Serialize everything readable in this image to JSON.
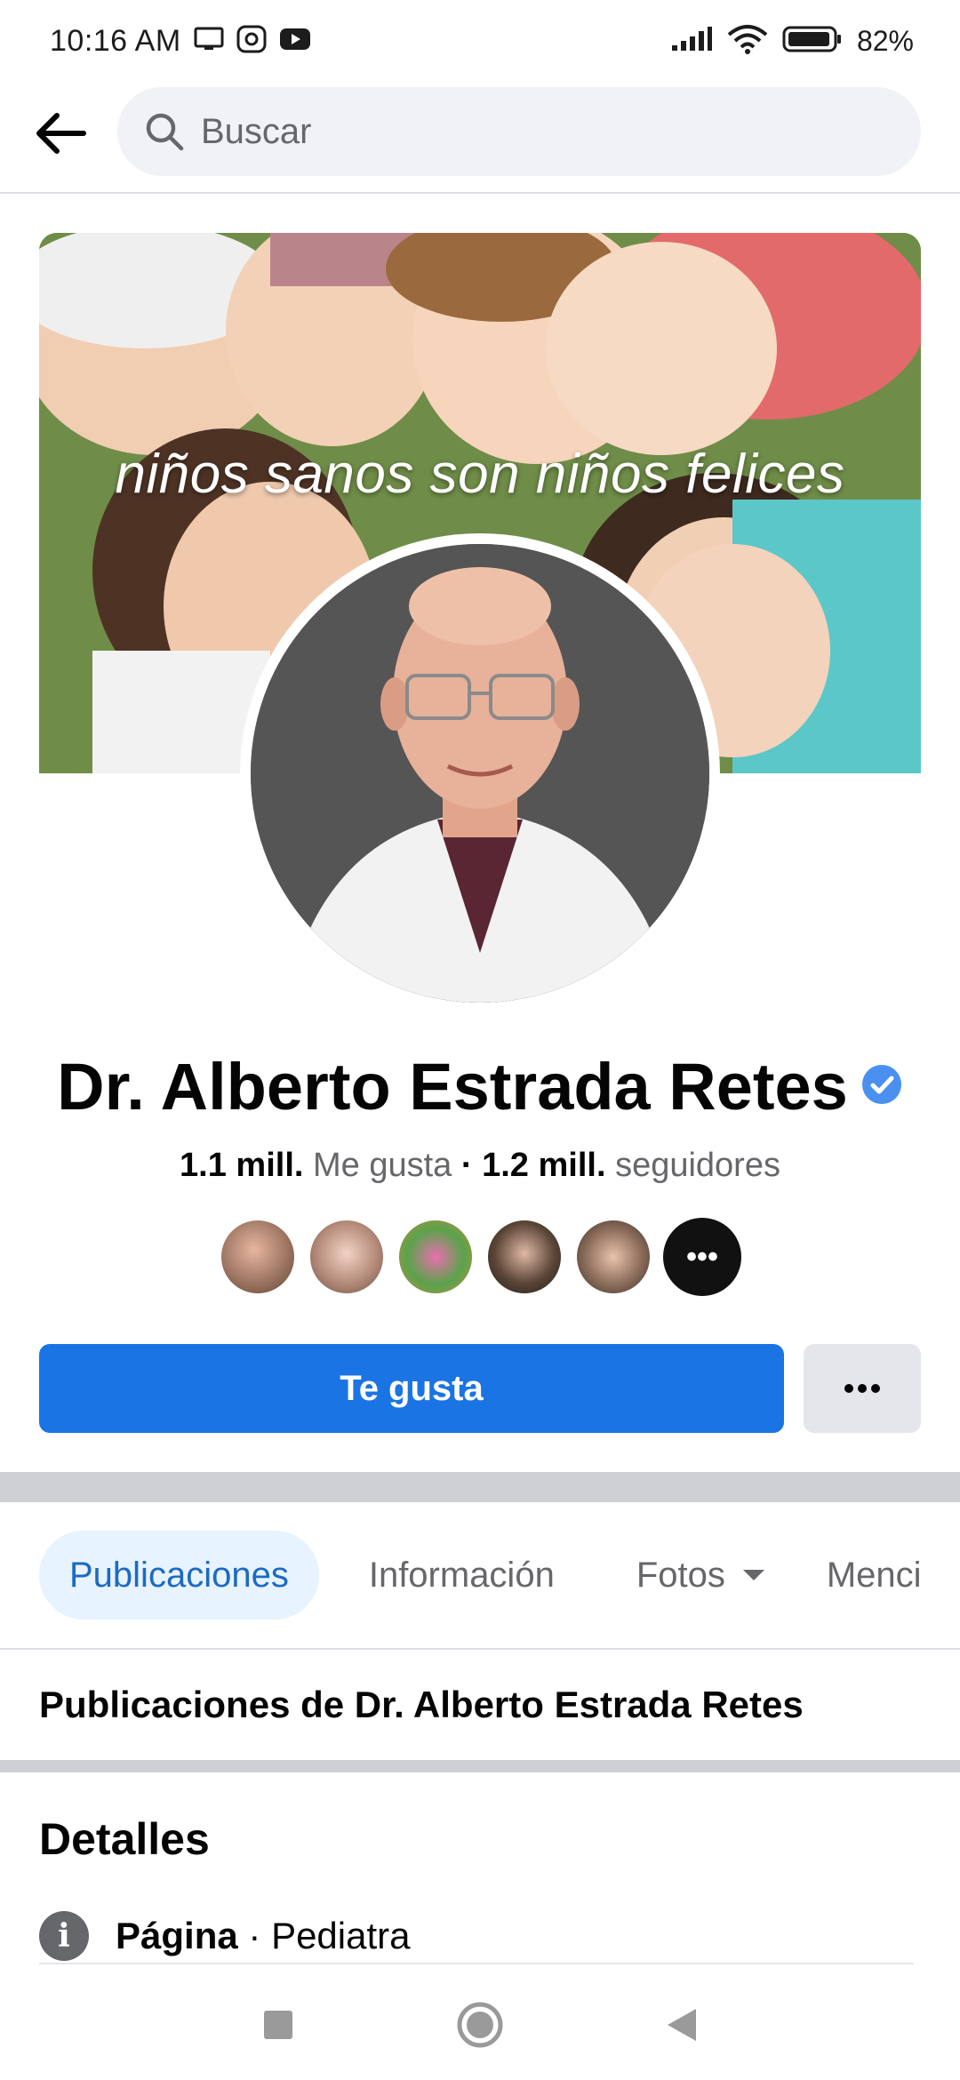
{
  "status_bar": {
    "time": "10:16 AM",
    "battery": "82%",
    "icons": [
      "screen-cast-icon",
      "record-icon",
      "youtube-icon",
      "signal-icon",
      "wifi-icon",
      "battery-icon"
    ]
  },
  "header": {
    "back_icon": "arrow-left-icon",
    "search_placeholder": "Buscar",
    "search_icon": "search-icon"
  },
  "cover": {
    "caption": "niños sanos son niños felices"
  },
  "profile": {
    "name": "Dr. Alberto Estrada Retes",
    "verified_icon": "verified-badge-icon",
    "likes_count": "1.1 mill.",
    "likes_label": "Me gusta",
    "separator": "·",
    "followers_count": "1.2 mill.",
    "followers_label": "seguidores",
    "friend_avatars": 5,
    "more_friends_label": "•••"
  },
  "actions": {
    "like_label": "Te gusta",
    "more_icon": "more-dots-icon"
  },
  "tabs": [
    {
      "label": "Publicaciones",
      "active": true
    },
    {
      "label": "Información",
      "active": false
    },
    {
      "label": "Fotos",
      "active": false,
      "has_dropdown": true
    },
    {
      "label": "Menci",
      "active": false
    }
  ],
  "posts_heading": "Publicaciones de Dr. Alberto Estrada Retes",
  "details": {
    "title": "Detalles",
    "category_label": "Página",
    "category_separator": "·",
    "category_value": "Pediatra"
  },
  "nav_bar": {
    "items": [
      "recents-square-icon",
      "home-circle-icon",
      "back-triangle-icon"
    ]
  },
  "colors": {
    "accent": "#1b74e4",
    "active_tab_bg": "#e7f3ff",
    "active_tab_text": "#1c6ac4",
    "muted_text": "#65676b",
    "divider": "#ced0d4"
  }
}
